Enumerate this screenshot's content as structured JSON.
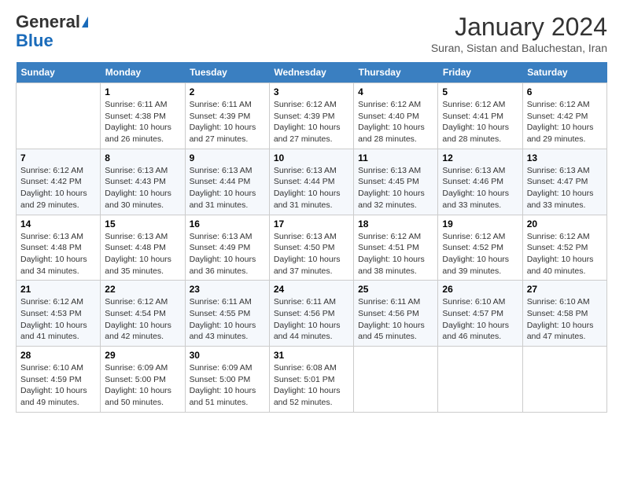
{
  "header": {
    "logo_general": "General",
    "logo_blue": "Blue",
    "title": "January 2024",
    "subtitle": "Suran, Sistan and Baluchestan, Iran"
  },
  "calendar": {
    "weekdays": [
      "Sunday",
      "Monday",
      "Tuesday",
      "Wednesday",
      "Thursday",
      "Friday",
      "Saturday"
    ],
    "weeks": [
      [
        {
          "num": "",
          "sunrise": "",
          "sunset": "",
          "daylight": ""
        },
        {
          "num": "1",
          "sunrise": "Sunrise: 6:11 AM",
          "sunset": "Sunset: 4:38 PM",
          "daylight": "Daylight: 10 hours and 26 minutes."
        },
        {
          "num": "2",
          "sunrise": "Sunrise: 6:11 AM",
          "sunset": "Sunset: 4:39 PM",
          "daylight": "Daylight: 10 hours and 27 minutes."
        },
        {
          "num": "3",
          "sunrise": "Sunrise: 6:12 AM",
          "sunset": "Sunset: 4:39 PM",
          "daylight": "Daylight: 10 hours and 27 minutes."
        },
        {
          "num": "4",
          "sunrise": "Sunrise: 6:12 AM",
          "sunset": "Sunset: 4:40 PM",
          "daylight": "Daylight: 10 hours and 28 minutes."
        },
        {
          "num": "5",
          "sunrise": "Sunrise: 6:12 AM",
          "sunset": "Sunset: 4:41 PM",
          "daylight": "Daylight: 10 hours and 28 minutes."
        },
        {
          "num": "6",
          "sunrise": "Sunrise: 6:12 AM",
          "sunset": "Sunset: 4:42 PM",
          "daylight": "Daylight: 10 hours and 29 minutes."
        }
      ],
      [
        {
          "num": "7",
          "sunrise": "Sunrise: 6:12 AM",
          "sunset": "Sunset: 4:42 PM",
          "daylight": "Daylight: 10 hours and 29 minutes."
        },
        {
          "num": "8",
          "sunrise": "Sunrise: 6:13 AM",
          "sunset": "Sunset: 4:43 PM",
          "daylight": "Daylight: 10 hours and 30 minutes."
        },
        {
          "num": "9",
          "sunrise": "Sunrise: 6:13 AM",
          "sunset": "Sunset: 4:44 PM",
          "daylight": "Daylight: 10 hours and 31 minutes."
        },
        {
          "num": "10",
          "sunrise": "Sunrise: 6:13 AM",
          "sunset": "Sunset: 4:44 PM",
          "daylight": "Daylight: 10 hours and 31 minutes."
        },
        {
          "num": "11",
          "sunrise": "Sunrise: 6:13 AM",
          "sunset": "Sunset: 4:45 PM",
          "daylight": "Daylight: 10 hours and 32 minutes."
        },
        {
          "num": "12",
          "sunrise": "Sunrise: 6:13 AM",
          "sunset": "Sunset: 4:46 PM",
          "daylight": "Daylight: 10 hours and 33 minutes."
        },
        {
          "num": "13",
          "sunrise": "Sunrise: 6:13 AM",
          "sunset": "Sunset: 4:47 PM",
          "daylight": "Daylight: 10 hours and 33 minutes."
        }
      ],
      [
        {
          "num": "14",
          "sunrise": "Sunrise: 6:13 AM",
          "sunset": "Sunset: 4:48 PM",
          "daylight": "Daylight: 10 hours and 34 minutes."
        },
        {
          "num": "15",
          "sunrise": "Sunrise: 6:13 AM",
          "sunset": "Sunset: 4:48 PM",
          "daylight": "Daylight: 10 hours and 35 minutes."
        },
        {
          "num": "16",
          "sunrise": "Sunrise: 6:13 AM",
          "sunset": "Sunset: 4:49 PM",
          "daylight": "Daylight: 10 hours and 36 minutes."
        },
        {
          "num": "17",
          "sunrise": "Sunrise: 6:13 AM",
          "sunset": "Sunset: 4:50 PM",
          "daylight": "Daylight: 10 hours and 37 minutes."
        },
        {
          "num": "18",
          "sunrise": "Sunrise: 6:12 AM",
          "sunset": "Sunset: 4:51 PM",
          "daylight": "Daylight: 10 hours and 38 minutes."
        },
        {
          "num": "19",
          "sunrise": "Sunrise: 6:12 AM",
          "sunset": "Sunset: 4:52 PM",
          "daylight": "Daylight: 10 hours and 39 minutes."
        },
        {
          "num": "20",
          "sunrise": "Sunrise: 6:12 AM",
          "sunset": "Sunset: 4:52 PM",
          "daylight": "Daylight: 10 hours and 40 minutes."
        }
      ],
      [
        {
          "num": "21",
          "sunrise": "Sunrise: 6:12 AM",
          "sunset": "Sunset: 4:53 PM",
          "daylight": "Daylight: 10 hours and 41 minutes."
        },
        {
          "num": "22",
          "sunrise": "Sunrise: 6:12 AM",
          "sunset": "Sunset: 4:54 PM",
          "daylight": "Daylight: 10 hours and 42 minutes."
        },
        {
          "num": "23",
          "sunrise": "Sunrise: 6:11 AM",
          "sunset": "Sunset: 4:55 PM",
          "daylight": "Daylight: 10 hours and 43 minutes."
        },
        {
          "num": "24",
          "sunrise": "Sunrise: 6:11 AM",
          "sunset": "Sunset: 4:56 PM",
          "daylight": "Daylight: 10 hours and 44 minutes."
        },
        {
          "num": "25",
          "sunrise": "Sunrise: 6:11 AM",
          "sunset": "Sunset: 4:56 PM",
          "daylight": "Daylight: 10 hours and 45 minutes."
        },
        {
          "num": "26",
          "sunrise": "Sunrise: 6:10 AM",
          "sunset": "Sunset: 4:57 PM",
          "daylight": "Daylight: 10 hours and 46 minutes."
        },
        {
          "num": "27",
          "sunrise": "Sunrise: 6:10 AM",
          "sunset": "Sunset: 4:58 PM",
          "daylight": "Daylight: 10 hours and 47 minutes."
        }
      ],
      [
        {
          "num": "28",
          "sunrise": "Sunrise: 6:10 AM",
          "sunset": "Sunset: 4:59 PM",
          "daylight": "Daylight: 10 hours and 49 minutes."
        },
        {
          "num": "29",
          "sunrise": "Sunrise: 6:09 AM",
          "sunset": "Sunset: 5:00 PM",
          "daylight": "Daylight: 10 hours and 50 minutes."
        },
        {
          "num": "30",
          "sunrise": "Sunrise: 6:09 AM",
          "sunset": "Sunset: 5:00 PM",
          "daylight": "Daylight: 10 hours and 51 minutes."
        },
        {
          "num": "31",
          "sunrise": "Sunrise: 6:08 AM",
          "sunset": "Sunset: 5:01 PM",
          "daylight": "Daylight: 10 hours and 52 minutes."
        },
        {
          "num": "",
          "sunrise": "",
          "sunset": "",
          "daylight": ""
        },
        {
          "num": "",
          "sunrise": "",
          "sunset": "",
          "daylight": ""
        },
        {
          "num": "",
          "sunrise": "",
          "sunset": "",
          "daylight": ""
        }
      ]
    ]
  }
}
